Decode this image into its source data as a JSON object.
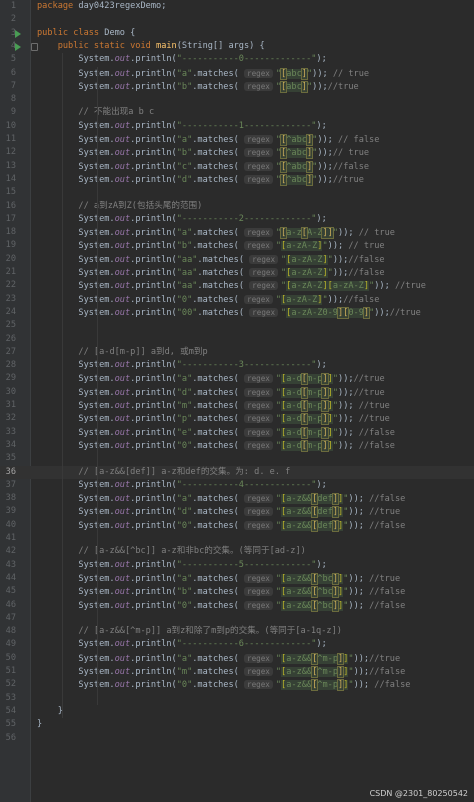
{
  "watermark": "CSDN @2301_80250542",
  "lines": [
    {
      "n": "1",
      "html": "<span class=\"kw\">package </span>day0423regexDemo;"
    },
    {
      "n": "2",
      "html": ""
    },
    {
      "n": "3",
      "run": true,
      "html": "<span class=\"kw\">public class </span>Demo {"
    },
    {
      "n": "4",
      "run": true,
      "fold": true,
      "html": "    <span class=\"kw\">public static void </span><span class=\"fn\">main</span>(String[] args) {"
    },
    {
      "n": "5",
      "html": "        System.<span class=\"out\">out</span>.println(<span class=\"str\">\"-----------0-------------\"</span>);"
    },
    {
      "n": "6",
      "html": "        System.<span class=\"out\">out</span>.println(<span class=\"str\">\"a\"</span>.matches( <span class=\"hint\">regex</span><span class=\"str\">\"</span><span class=\"rx\"><span class=\"br2\">[</span>abc<span class=\"br2\">]</span></span><span class=\"str\">\"</span>)); <span class=\"cm\">// true</span>"
    },
    {
      "n": "7",
      "html": "        System.<span class=\"out\">out</span>.println(<span class=\"str\">\"b\"</span>.matches( <span class=\"hint\">regex</span><span class=\"str\">\"</span><span class=\"rx\"><span class=\"br2\">[</span>abc<span class=\"br2\">]</span></span><span class=\"str\">\"</span>));<span class=\"cm\">//true</span>"
    },
    {
      "n": "8",
      "html": ""
    },
    {
      "n": "9",
      "html": "        <span class=\"cm\">// 不能出现a b c</span>"
    },
    {
      "n": "10",
      "html": "        System.<span class=\"out\">out</span>.println(<span class=\"str\">\"-----------1-------------\"</span>);"
    },
    {
      "n": "11",
      "html": "        System.<span class=\"out\">out</span>.println(<span class=\"str\">\"a\"</span>.matches( <span class=\"hint\">regex</span><span class=\"str\">\"</span><span class=\"rx\"><span class=\"br2\">[</span>^abc<span class=\"br2\">]</span></span><span class=\"str\">\"</span>)); <span class=\"cm\">// false</span>"
    },
    {
      "n": "12",
      "html": "        System.<span class=\"out\">out</span>.println(<span class=\"str\">\"b\"</span>.matches( <span class=\"hint\">regex</span><span class=\"str\">\"</span><span class=\"rx\"><span class=\"br2\">[</span>^abc<span class=\"br2\">]</span></span><span class=\"str\">\"</span>));<span class=\"cm\">// true</span>"
    },
    {
      "n": "13",
      "html": "        System.<span class=\"out\">out</span>.println(<span class=\"str\">\"c\"</span>.matches( <span class=\"hint\">regex</span><span class=\"str\">\"</span><span class=\"rx\"><span class=\"br2\">[</span>^abc<span class=\"br2\">]</span></span><span class=\"str\">\"</span>));<span class=\"cm\">//false</span>"
    },
    {
      "n": "14",
      "html": "        System.<span class=\"out\">out</span>.println(<span class=\"str\">\"d\"</span>.matches( <span class=\"hint\">regex</span><span class=\"str\">\"</span><span class=\"rx\"><span class=\"br2\">[</span>^abc<span class=\"br2\">]</span></span><span class=\"str\">\"</span>));<span class=\"cm\">//true</span>"
    },
    {
      "n": "15",
      "html": ""
    },
    {
      "n": "16",
      "html": "        <span class=\"cm\">// a到zA到Z(包括头尾的范围)</span>"
    },
    {
      "n": "17",
      "html": "        System.<span class=\"out\">out</span>.println(<span class=\"str\">\"-----------2-------------\"</span>);"
    },
    {
      "n": "18",
      "html": "        System.<span class=\"out\">out</span>.println(<span class=\"str\">\"a\"</span>.matches( <span class=\"hint\">regex</span><span class=\"str\">\"</span><span class=\"rx\"><span class=\"br2\">[</span>a-z<span class=\"br2\">[</span>A-Z<span class=\"br2\">]]</span></span><span class=\"str\">\"</span>)); <span class=\"cm\">// true</span>"
    },
    {
      "n": "19",
      "html": "        System.<span class=\"out\">out</span>.println(<span class=\"str\">\"b\"</span>.matches( <span class=\"hint\">regex</span><span class=\"str\">\"</span><span class=\"rx\"><span class=\"br\">[</span>a-zA-Z<span class=\"br\">]</span></span><span class=\"str\">\"</span>)); <span class=\"cm\">// true</span>"
    },
    {
      "n": "20",
      "html": "        System.<span class=\"out\">out</span>.println(<span class=\"str\">\"aa\"</span>.matches( <span class=\"hint\">regex</span><span class=\"str\">\"</span><span class=\"rx\"><span class=\"br\">[</span>a-zA-Z<span class=\"br\">]</span></span><span class=\"str\">\"</span>));<span class=\"cm\">//false</span>"
    },
    {
      "n": "21",
      "html": "        System.<span class=\"out\">out</span>.println(<span class=\"str\">\"aa\"</span>.matches( <span class=\"hint\">regex</span><span class=\"str\">\"</span><span class=\"rx\"><span class=\"br\">[</span>a-zA-Z<span class=\"br\">]</span></span><span class=\"str\">\"</span>));<span class=\"cm\">//false</span>"
    },
    {
      "n": "22",
      "html": "        System.<span class=\"out\">out</span>.println(<span class=\"str\">\"aa\"</span>.matches( <span class=\"hint\">regex</span><span class=\"str\">\"</span><span class=\"rx\"><span class=\"br\">[</span>a-zA-Z<span class=\"br\">][</span>a-zA-Z<span class=\"br\">]</span></span><span class=\"str\">\"</span>)); <span class=\"cm\">//true</span>"
    },
    {
      "n": "23",
      "html": "        System.<span class=\"out\">out</span>.println(<span class=\"str\">\"0\"</span>.matches( <span class=\"hint\">regex</span><span class=\"str\">\"</span><span class=\"rx\"><span class=\"br\">[</span>a-zA-Z<span class=\"br\">]</span></span><span class=\"str\">\"</span>));<span class=\"cm\">//false</span>"
    },
    {
      "n": "24",
      "html": "        System.<span class=\"out\">out</span>.println(<span class=\"str\">\"00\"</span>.matches( <span class=\"hint\">regex</span><span class=\"str\">\"</span><span class=\"rx\"><span class=\"br\">[</span>a-zA-Z0-9<span class=\"br2\">][</span>0-9<span class=\"br2\">]</span></span><span class=\"str\">\"</span>));<span class=\"cm\">//true</span>"
    },
    {
      "n": "25",
      "html": ""
    },
    {
      "n": "26",
      "html": ""
    },
    {
      "n": "27",
      "html": "        <span class=\"cm\">// [a-d[m-p]] a到d, 或m到p</span>"
    },
    {
      "n": "28",
      "html": "        System.<span class=\"out\">out</span>.println(<span class=\"str\">\"-----------3-------------\"</span>);"
    },
    {
      "n": "29",
      "html": "        System.<span class=\"out\">out</span>.println(<span class=\"str\">\"a\"</span>.matches( <span class=\"hint\">regex</span><span class=\"str\">\"</span><span class=\"rx\"><span class=\"br\">[</span>a-d<span class=\"br2\">[</span>m-p<span class=\"br2\">]</span><span class=\"br\">]</span></span><span class=\"str\">\"</span>));<span class=\"cm\">//true</span>"
    },
    {
      "n": "30",
      "html": "        System.<span class=\"out\">out</span>.println(<span class=\"str\">\"d\"</span>.matches( <span class=\"hint\">regex</span><span class=\"str\">\"</span><span class=\"rx\"><span class=\"br\">[</span>a-d<span class=\"br2\">[</span>m-p<span class=\"br2\">]</span><span class=\"br\">]</span></span><span class=\"str\">\"</span>));<span class=\"cm\">//true</span>"
    },
    {
      "n": "31",
      "html": "        System.<span class=\"out\">out</span>.println(<span class=\"str\">\"m\"</span>.matches( <span class=\"hint\">regex</span><span class=\"str\">\"</span><span class=\"rx\"><span class=\"br\">[</span>a-d<span class=\"br2\">[</span>m-p<span class=\"br2\">]</span><span class=\"br\">]</span></span><span class=\"str\">\"</span>)); <span class=\"cm\">//true</span>"
    },
    {
      "n": "32",
      "html": "        System.<span class=\"out\">out</span>.println(<span class=\"str\">\"p\"</span>.matches( <span class=\"hint\">regex</span><span class=\"str\">\"</span><span class=\"rx\"><span class=\"br\">[</span>a-d<span class=\"br2\">[</span>m-p<span class=\"br2\">]</span><span class=\"br\">]</span></span><span class=\"str\">\"</span>)); <span class=\"cm\">//true</span>"
    },
    {
      "n": "33",
      "html": "        System.<span class=\"out\">out</span>.println(<span class=\"str\">\"e\"</span>.matches( <span class=\"hint\">regex</span><span class=\"str\">\"</span><span class=\"rx\"><span class=\"br\">[</span>a-d<span class=\"br2\">[</span>m-p<span class=\"br2\">]</span><span class=\"br\">]</span></span><span class=\"str\">\"</span>)); <span class=\"cm\">//false</span>"
    },
    {
      "n": "34",
      "html": "        System.<span class=\"out\">out</span>.println(<span class=\"str\">\"0\"</span>.matches( <span class=\"hint\">regex</span><span class=\"str\">\"</span><span class=\"rx\"><span class=\"br\">[</span>a-d<span class=\"br2\">[</span>m-p<span class=\"br2\">]</span><span class=\"br\">]</span></span><span class=\"str\">\"</span>)); <span class=\"cm\">//false</span>"
    },
    {
      "n": "35",
      "html": ""
    },
    {
      "n": "36",
      "current": true,
      "html": "        <span class=\"cm\">// [a-z&amp;&amp;[def]] a-z和def的交集。为: d. e. f</span>"
    },
    {
      "n": "37",
      "html": "        System.<span class=\"out\">out</span>.println(<span class=\"str\">\"-----------4-------------\"</span>);"
    },
    {
      "n": "38",
      "html": "        System.<span class=\"out\">out</span>.println(<span class=\"str\">\"a\"</span>.matches( <span class=\"hint\">regex</span><span class=\"str\">\"</span><span class=\"rx\"><span class=\"br\">[</span>a-z&amp;&amp;<span class=\"br2\">[</span>def<span class=\"br2\">]</span><span class=\"br\">]</span></span><span class=\"str\">\"</span>)); <span class=\"cm\">//false</span>"
    },
    {
      "n": "39",
      "html": "        System.<span class=\"out\">out</span>.println(<span class=\"str\">\"d\"</span>.matches( <span class=\"hint\">regex</span><span class=\"str\">\"</span><span class=\"rx\"><span class=\"br\">[</span>a-z&amp;&amp;<span class=\"br2\">[</span>def<span class=\"br2\">]</span><span class=\"br\">]</span></span><span class=\"str\">\"</span>)); <span class=\"cm\">//true</span>"
    },
    {
      "n": "40",
      "html": "        System.<span class=\"out\">out</span>.println(<span class=\"str\">\"0\"</span>.matches( <span class=\"hint\">regex</span><span class=\"str\">\"</span><span class=\"rx\"><span class=\"br\">[</span>a-z&amp;&amp;<span class=\"br2\">[</span>def<span class=\"br2\">]</span><span class=\"br\">]</span></span><span class=\"str\">\"</span>)); <span class=\"cm\">//false</span>"
    },
    {
      "n": "41",
      "html": ""
    },
    {
      "n": "42",
      "html": "        <span class=\"cm\">// [a-z&amp;&amp;[^bc]] a-z和非bc的交集。(等同于[ad-z])</span>"
    },
    {
      "n": "43",
      "html": "        System.<span class=\"out\">out</span>.println(<span class=\"str\">\"-----------5-------------\"</span>);"
    },
    {
      "n": "44",
      "html": "        System.<span class=\"out\">out</span>.println(<span class=\"str\">\"a\"</span>.matches( <span class=\"hint\">regex</span><span class=\"str\">\"</span><span class=\"rx\"><span class=\"br\">[</span>a-z&amp;&amp;<span class=\"br2\">[</span>^bc<span class=\"br2\">]</span><span class=\"br\">]</span></span><span class=\"str\">\"</span>)); <span class=\"cm\">//true</span>"
    },
    {
      "n": "45",
      "html": "        System.<span class=\"out\">out</span>.println(<span class=\"str\">\"b\"</span>.matches( <span class=\"hint\">regex</span><span class=\"str\">\"</span><span class=\"rx\"><span class=\"br\">[</span>a-z&amp;&amp;<span class=\"br2\">[</span>^bc<span class=\"br2\">]</span><span class=\"br\">]</span></span><span class=\"str\">\"</span>)); <span class=\"cm\">//false</span>"
    },
    {
      "n": "46",
      "html": "        System.<span class=\"out\">out</span>.println(<span class=\"str\">\"0\"</span>.matches( <span class=\"hint\">regex</span><span class=\"str\">\"</span><span class=\"rx\"><span class=\"br\">[</span>a-z&amp;&amp;<span class=\"br2\">[</span>^bc<span class=\"br2\">]</span><span class=\"br\">]</span></span><span class=\"str\">\"</span>)); <span class=\"cm\">//false</span>"
    },
    {
      "n": "47",
      "html": ""
    },
    {
      "n": "48",
      "html": "        <span class=\"cm\">// [a-z&amp;&amp;[^m-p]] a到z和除了m到p的交集。(等同于[a-1q-z])</span>"
    },
    {
      "n": "49",
      "html": "        System.<span class=\"out\">out</span>.println(<span class=\"str\">\"-----------6-------------\"</span>);"
    },
    {
      "n": "50",
      "html": "        System.<span class=\"out\">out</span>.println(<span class=\"str\">\"a\"</span>.matches( <span class=\"hint\">regex</span><span class=\"str\">\"</span><span class=\"rx\"><span class=\"br\">[</span>a-z&amp;&amp;<span class=\"br2\">[</span>^m-p<span class=\"br2\">]</span><span class=\"br\">]</span></span><span class=\"str\">\"</span>));<span class=\"cm\">//true</span>"
    },
    {
      "n": "51",
      "html": "        System.<span class=\"out\">out</span>.println(<span class=\"str\">\"m\"</span>.matches( <span class=\"hint\">regex</span><span class=\"str\">\"</span><span class=\"rx\"><span class=\"br\">[</span>a-z&amp;&amp;<span class=\"br2\">[</span>^m-p<span class=\"br2\">]</span><span class=\"br\">]</span></span><span class=\"str\">\"</span>));<span class=\"cm\">//false</span>"
    },
    {
      "n": "52",
      "html": "        System.<span class=\"out\">out</span>.println(<span class=\"str\">\"0\"</span>.matches( <span class=\"hint\">regex</span><span class=\"str\">\"</span><span class=\"rx\"><span class=\"br\">[</span>a-z&amp;&amp;<span class=\"br2\">[</span>^m-p<span class=\"br2\">]</span><span class=\"br\">]</span></span><span class=\"str\">\"</span>)); <span class=\"cm\">//false</span>"
    },
    {
      "n": "53",
      "html": ""
    },
    {
      "n": "54",
      "html": "    }"
    },
    {
      "n": "55",
      "html": "}"
    },
    {
      "n": "56",
      "html": ""
    }
  ]
}
